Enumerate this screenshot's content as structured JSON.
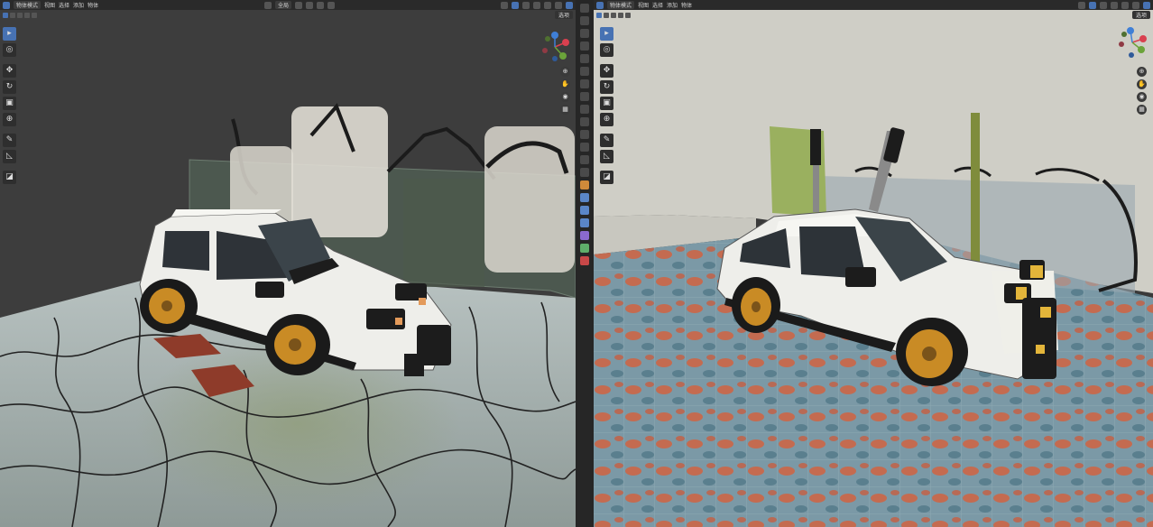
{
  "viewports": [
    {
      "mode_label": "物体模式",
      "menu": [
        "视图",
        "选择",
        "添加",
        "物体"
      ],
      "transform_orientation": "全局",
      "options_label": "选项",
      "accent_color": "#4772b3"
    },
    {
      "mode_label": "物体模式",
      "menu": [
        "视图",
        "选择",
        "添加",
        "物体"
      ],
      "options_label": "选项",
      "accent_color": "#4772b3"
    }
  ],
  "toolbar_tools": [
    "select-box-icon",
    "cursor-icon",
    "move-icon",
    "rotate-icon",
    "scale-icon",
    "transform-icon",
    "annotate-icon",
    "measure-icon",
    "add-cube-icon"
  ],
  "navigation_icons": [
    "zoom-icon",
    "pan-hand-icon",
    "camera-icon",
    "grid-icon"
  ],
  "gizmo_axes": {
    "x": "X",
    "y": "Y",
    "z": "Z"
  },
  "axis_colors": {
    "x": "#d9404f",
    "y": "#6ba33a",
    "z": "#3f7fd6"
  }
}
